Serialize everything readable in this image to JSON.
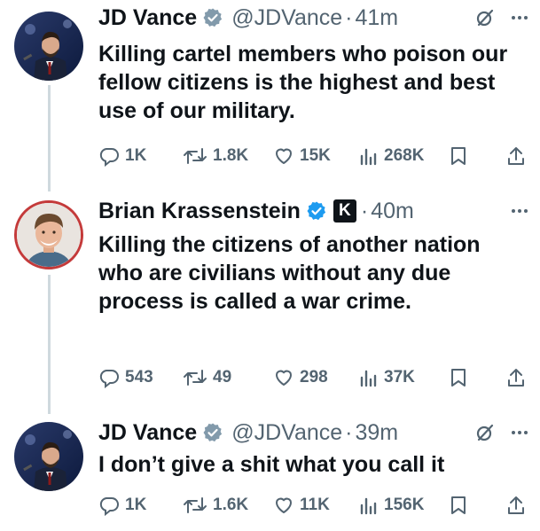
{
  "colors": {
    "verified": "#1d9bf0",
    "muted": "#536471",
    "text": "#0f1419",
    "thread_line": "#cfd9de"
  },
  "tweets": [
    {
      "author": "JD Vance",
      "handle": "@JDVance",
      "separator": "·",
      "time": "41m",
      "verified_icon": "gray-verified-badge",
      "text": "Killing cartel members who poison our fellow citizens is the highest and best use of our military.",
      "replies": "1K",
      "reposts": "1.8K",
      "likes": "15K",
      "views": "268K"
    },
    {
      "author": "Brian Krassenstein",
      "handle": "",
      "affiliate_badge": "K",
      "separator": "·",
      "time": "40m",
      "verified_icon": "blue-verified-badge",
      "text": "Killing the citizens of another nation who are civilians without any due process is called a war crime.",
      "replies": "543",
      "reposts": "49",
      "likes": "298",
      "views": "37K"
    },
    {
      "author": "JD Vance",
      "handle": "@JDVance",
      "separator": "·",
      "time": "39m",
      "verified_icon": "gray-verified-badge",
      "text": "I don’t give a shit what you call it",
      "replies": "1K",
      "reposts": "1.6K",
      "likes": "11K",
      "views": "156K"
    }
  ]
}
